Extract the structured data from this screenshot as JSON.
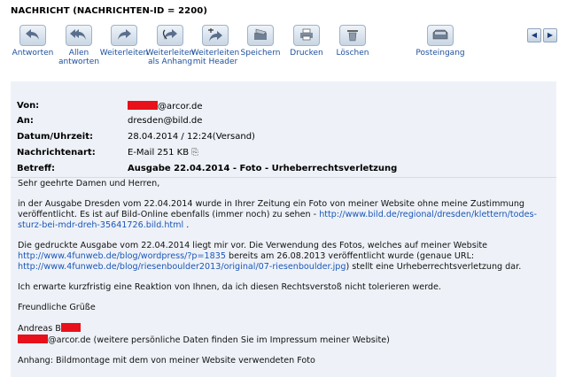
{
  "window": {
    "title": "NACHRICHT (NACHRICHTEN-ID = 2200)"
  },
  "toolbar": {
    "buttons": [
      {
        "label": "Antworten",
        "icon": "reply-icon"
      },
      {
        "label": "Allen antworten",
        "icon": "reply-all-icon"
      },
      {
        "label": "Weiterleiten",
        "icon": "forward-icon"
      },
      {
        "label": "Weiterleiten als Anhang",
        "icon": "forward-attachment-icon"
      },
      {
        "label": "Weiterleiten mit Header",
        "icon": "forward-header-icon"
      },
      {
        "label": "Speichern",
        "icon": "save-icon"
      },
      {
        "label": "Drucken",
        "icon": "print-icon"
      },
      {
        "label": "Löschen",
        "icon": "trash-icon"
      },
      {
        "label": "Posteingang",
        "icon": "inbox-icon"
      }
    ],
    "nav": {
      "prev": "◀",
      "next": "▶"
    }
  },
  "header": {
    "from_label": "Von:",
    "from_value": "@arcor.de",
    "to_label": "An:",
    "to_value": "dresden@bild.de",
    "date_label": "Datum/Uhrzeit:",
    "date_value": "28.04.2014 / 12:24(Versand)",
    "type_label": "Nachrichtenart:",
    "type_value": "E-Mail  251 KB",
    "subject_label": "Betreff:",
    "subject_value": "Ausgabe 22.04.2014 - Foto - Urheberrechtsverletzung"
  },
  "body": {
    "greeting": "Sehr geehrte Damen und Herren,",
    "p1_text": "in der Ausgabe Dresden vom 22.04.2014 wurde in Ihrer Zeitung ein Foto von meiner Website ohne meine Zustimmung veröffentlicht. Es ist auf Bild-Online ebenfalls (immer noch) zu sehen - ",
    "p1_link": "http://www.bild.de/regional/dresden/klettern/todes-sturz-bei-mdr-dreh-35641726.bild.html",
    "p1_end": " .",
    "p2_text": "Die gedruckte Ausgabe vom 22.04.2014 liegt mir vor. Die Verwendung des Fotos, welches auf meiner Website ",
    "p2_link1": "http://www.4funweb.de/blog/wordpress/?p=1835",
    "p2_mid": " bereits am 26.08.2013 veröffentlicht wurde (genaue URL: ",
    "p2_link2": "http://www.4funweb.de/blog/riesenboulder2013/original/07-riesenboulder.jpg",
    "p2_end": ") stellt eine Urheberrechtsverletzung dar.",
    "p3": "Ich erwarte kurzfristig eine Reaktion von Ihnen, da ich diesen Rechtsverstoß nicht tolerieren werde.",
    "closing": "Freundliche Grüße",
    "name": "Andreas B",
    "contact_email": "@arcor.de",
    "contact_note": " (weitere persönliche Daten finden Sie im Impressum meiner Website)",
    "attachment": "Anhang: Bildmontage mit dem von meiner Website verwendeten Foto"
  },
  "colors": {
    "panel_bg": "#eef2f8",
    "link": "#1a56b8",
    "redaction": "#e8101a",
    "toolbar_label": "#1c4f9c"
  }
}
